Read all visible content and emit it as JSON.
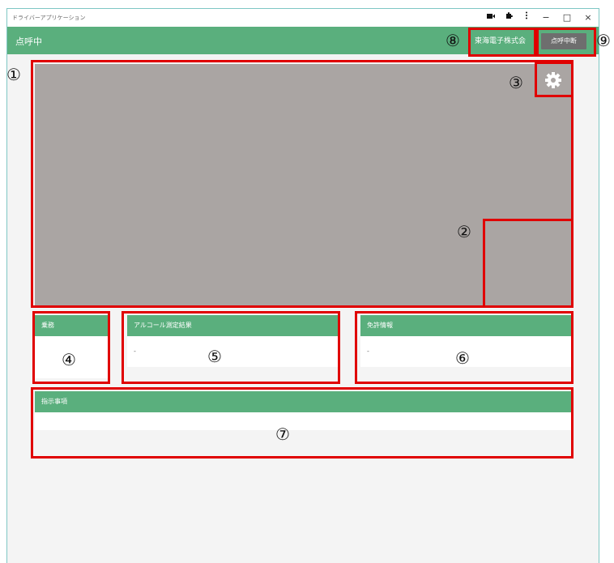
{
  "window": {
    "title": "ドライバーアプリケーション",
    "controls": {
      "minimize": "−",
      "maximize": "□",
      "close": "×"
    },
    "icons": [
      "camera-icon",
      "puzzle-icon",
      "kebab-menu-icon"
    ]
  },
  "header": {
    "title": "点呼中",
    "company": "東海電子株式会",
    "stop_button": "点呼中断"
  },
  "cards": {
    "duty": {
      "title": "乗務",
      "value": ""
    },
    "alcohol": {
      "title": "アルコール測定結果",
      "value": "-"
    },
    "license": {
      "title": "免許情報",
      "value": "-"
    },
    "instructions": {
      "title": "指示事項",
      "value": ""
    }
  },
  "callouts": [
    "①",
    "②",
    "③",
    "④",
    "⑤",
    "⑥",
    "⑦",
    "⑧",
    "⑨"
  ],
  "colors": {
    "accent": "#5aaf7d",
    "callout_border": "#e00000",
    "video_bg": "#aaa5a3",
    "stop_button_bg": "#6e6e6e"
  }
}
